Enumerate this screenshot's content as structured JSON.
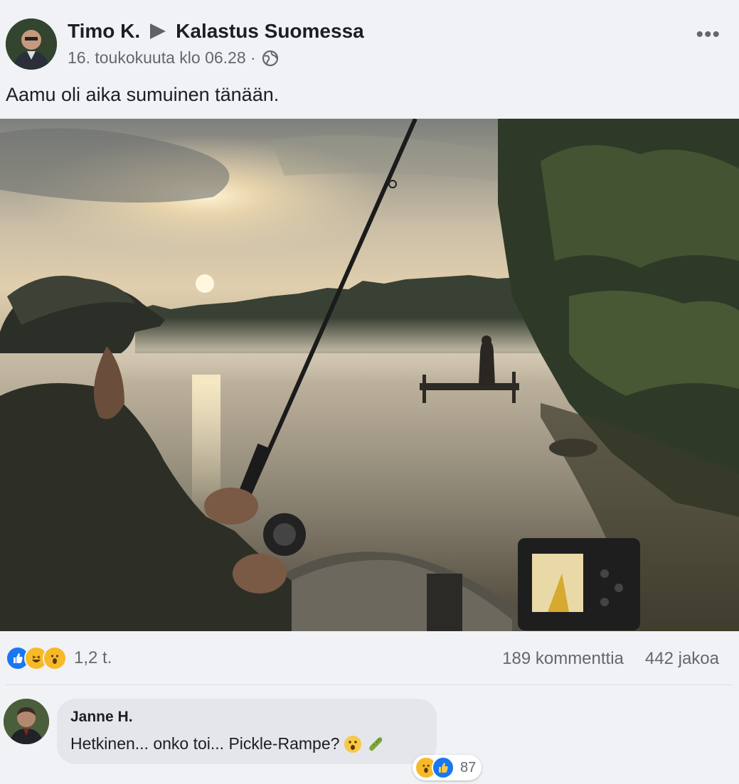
{
  "post": {
    "author": "Timo K.",
    "group": "Kalastus Suomessa",
    "timestamp": "16. toukokuuta klo 06.28 ·",
    "more_label": "•••",
    "caption": "Aamu oli aika sumuinen tänään."
  },
  "photo": {
    "type": "photo"
  },
  "stats": {
    "reaction_count": "1,2 t.",
    "comments": "189 kommenttia",
    "shares": "442 jakoa"
  },
  "comment": {
    "author": "Janne H.",
    "text": "Hetkinen... onko toi... Pickle-Rampe?",
    "reaction_count": "87"
  },
  "colors": {
    "like_blue": "#1877f2",
    "haha_yellow": "#f7b928",
    "text_secondary": "#65676b",
    "bubble_bg": "#e4e6eb"
  },
  "icons": [
    "globe-icon",
    "more-icon",
    "like-reaction-icon",
    "haha-reaction-icon",
    "wow-reaction-icon",
    "surprised-emoji",
    "pickle-emoji"
  ]
}
